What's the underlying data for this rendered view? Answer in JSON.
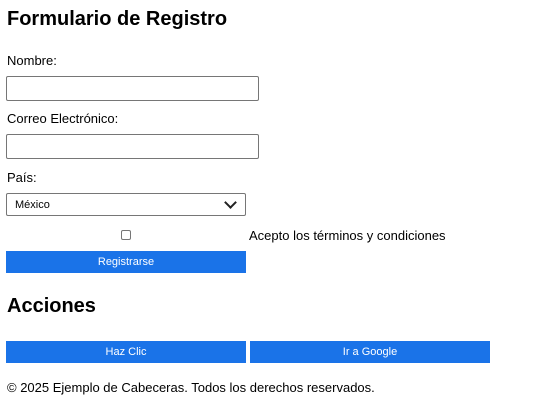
{
  "form": {
    "title": "Formulario de Registro",
    "name_label": "Nombre:",
    "name_value": "",
    "email_label": "Correo Electrónico:",
    "email_value": "",
    "country_label": "País:",
    "country_selected": "México",
    "terms_label": "Acepto los términos y condiciones",
    "terms_checked": false,
    "submit_label": "Registrarse"
  },
  "actions": {
    "title": "Acciones",
    "click_label": "Haz Clic",
    "google_label": "Ir a Google"
  },
  "footer": {
    "text": "© 2025 Ejemplo de Cabeceras. Todos los derechos reservados."
  },
  "colors": {
    "button_bg": "#1a73e8",
    "button_text": "#ffffff"
  }
}
